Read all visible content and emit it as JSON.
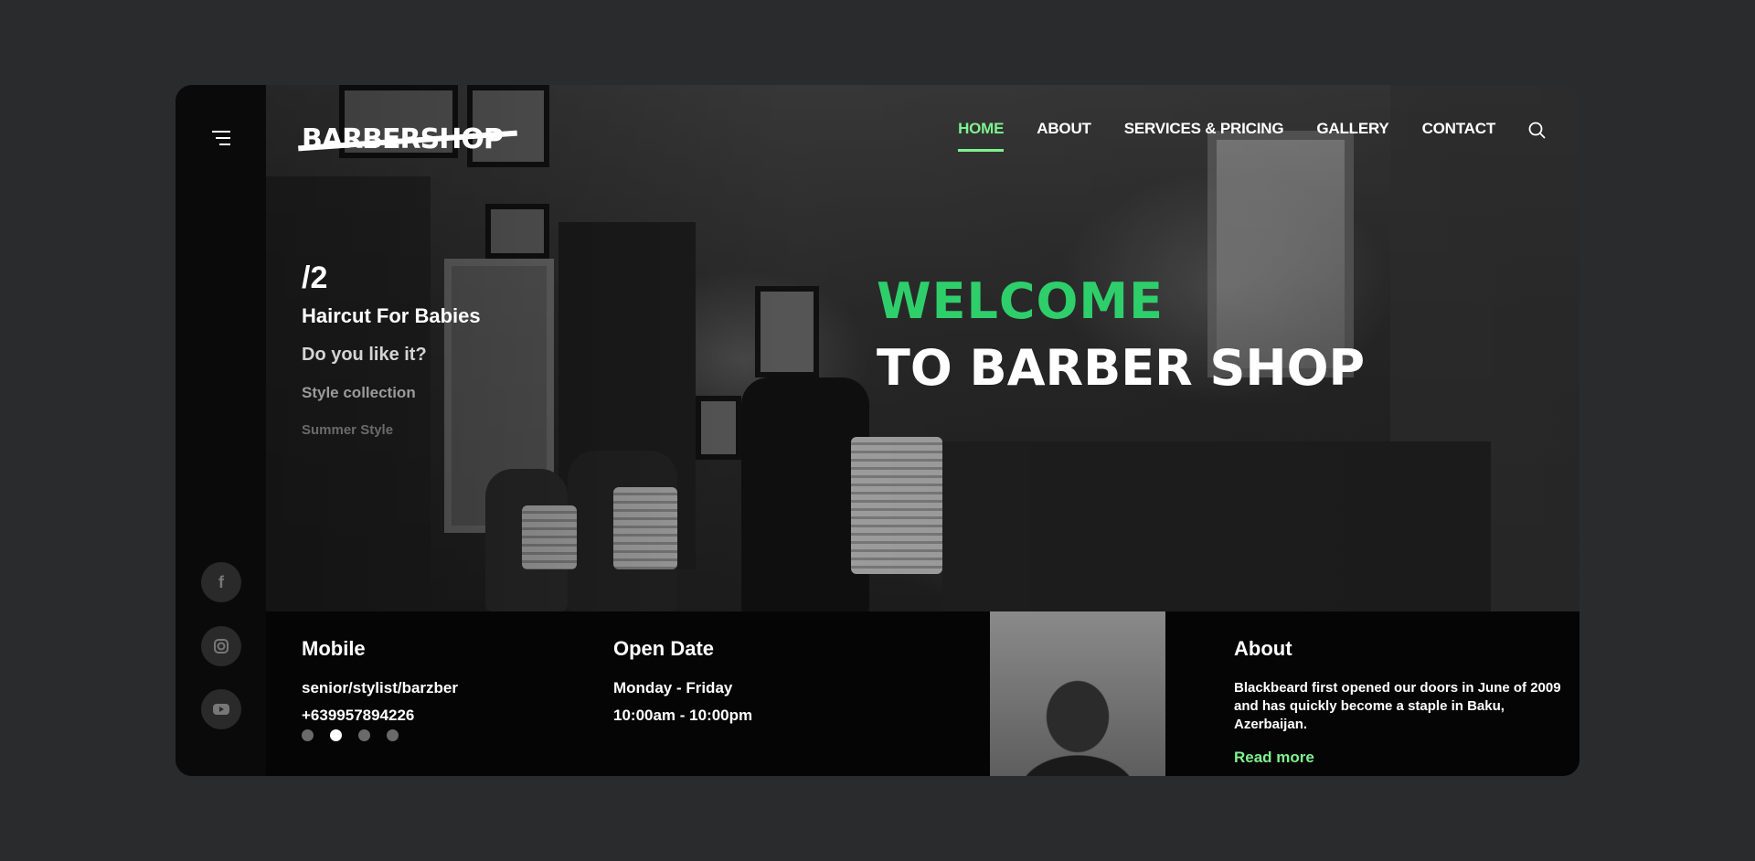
{
  "brand": {
    "logo": "BARBERSHOP"
  },
  "nav": {
    "items": [
      {
        "label": "HOME",
        "active": true
      },
      {
        "label": "ABOUT",
        "active": false
      },
      {
        "label": "SERVICES & PRICING",
        "active": false
      },
      {
        "label": "GALLERY",
        "active": false
      },
      {
        "label": "CONTACT",
        "active": false
      }
    ]
  },
  "slider": {
    "index": "/2",
    "titles": [
      "Haircut For Babies",
      "Do you like it?",
      "Style collection",
      "Summer Style"
    ],
    "active_dot": 1,
    "dot_count": 4
  },
  "hero": {
    "headline": "WELCOME",
    "subheadline": "TO BARBER SHOP"
  },
  "social": [
    {
      "icon": "facebook-icon",
      "glyph": "f"
    },
    {
      "icon": "instagram-icon",
      "glyph": ""
    },
    {
      "icon": "youtube-icon",
      "glyph": ""
    }
  ],
  "info": {
    "mobile": {
      "title": "Mobile",
      "line1": "senior/stylist/barzber",
      "line2": "+639957894226"
    },
    "open": {
      "title": "Open Date",
      "line1": "Monday - Friday",
      "line2": "10:00am - 10:00pm"
    },
    "about": {
      "title": "About",
      "text": "Blackbeard first opened our doors in June of 2009 and has quickly become a staple in Baku, Azerbaijan.",
      "link": "Read more"
    }
  },
  "colors": {
    "accent": "#7ef28e",
    "headline": "#2ecf6b",
    "background": "#2a2b2d"
  }
}
